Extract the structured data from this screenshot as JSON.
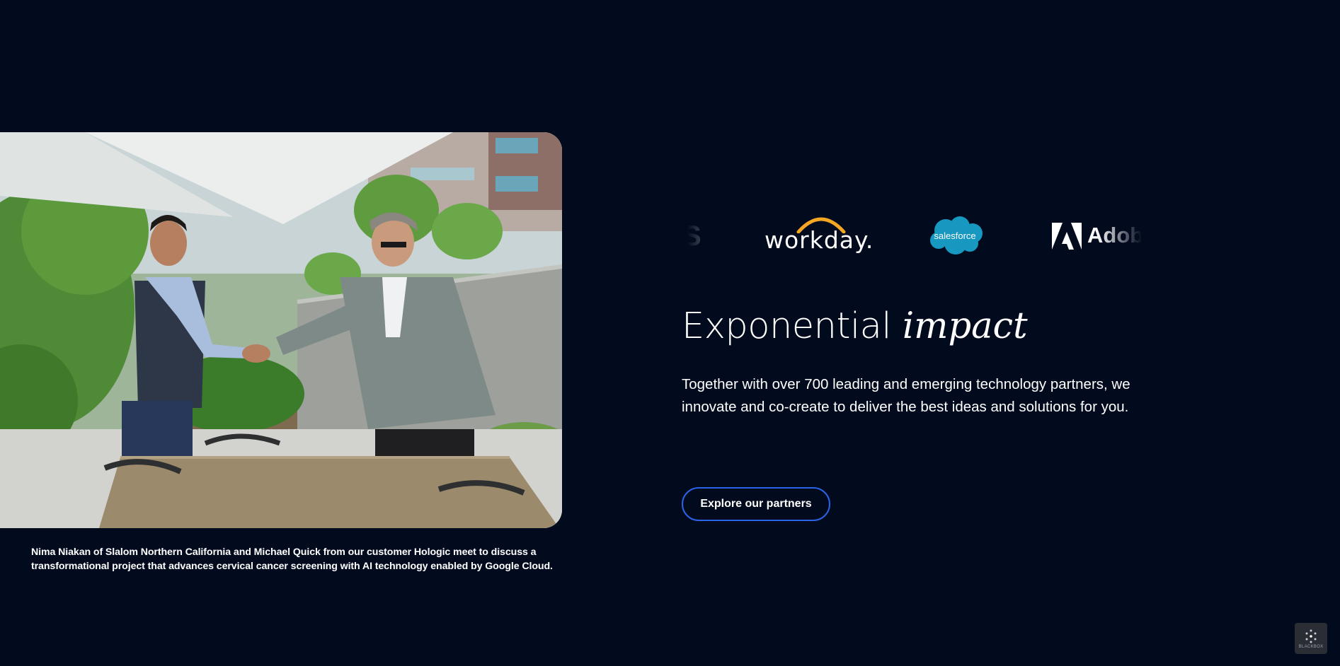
{
  "partners_logos": {
    "items": [
      {
        "name": "aws",
        "text": "S"
      },
      {
        "name": "workday",
        "text": "workday."
      },
      {
        "name": "salesforce",
        "text": "salesforce"
      },
      {
        "name": "adobe",
        "text": "Adobe"
      }
    ]
  },
  "hero": {
    "title_plain": "Exponential",
    "title_italic": "impact",
    "body": "Together with over 700 leading and emerging technology partners, we innovate and co-create to deliver the best ideas and solutions for you.",
    "cta_label": "Explore our partners"
  },
  "photo": {
    "caption": "Nima Niakan of Slalom Northern California and Michael Quick from our customer Hologic meet to discuss a transformational project that advances cervical cancer screening with AI technology enabled by Google Cloud."
  },
  "badge": {
    "text": "BLACKBOX"
  },
  "colors": {
    "background": "#020a1e",
    "cta_border": "#2b63e8",
    "workday_arc": "#f5a623",
    "salesforce_cloud": "#1798c1"
  }
}
